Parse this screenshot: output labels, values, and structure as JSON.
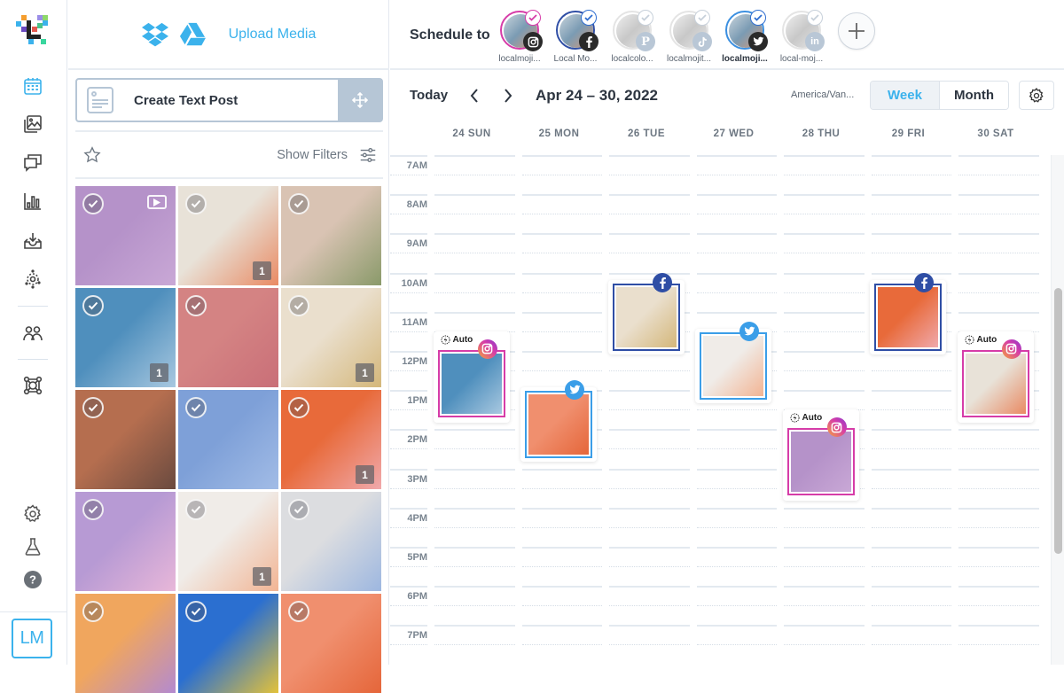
{
  "nav": {
    "items": [
      {
        "name": "calendar",
        "active": true
      },
      {
        "name": "media-library",
        "active": false
      },
      {
        "name": "conversations",
        "active": false
      },
      {
        "name": "analytics",
        "active": false
      },
      {
        "name": "inbox",
        "active": false
      },
      {
        "name": "discover",
        "active": false
      },
      {
        "name": "team",
        "active": false
      },
      {
        "name": "integrations",
        "active": false
      },
      {
        "name": "settings",
        "active": false
      },
      {
        "name": "labs",
        "active": false
      },
      {
        "name": "help",
        "active": false
      }
    ],
    "user_initials": "LM"
  },
  "media_panel": {
    "upload_label": "Upload Media",
    "sources": [
      "dropbox",
      "google-drive"
    ],
    "create_text_post_label": "Create Text Post",
    "show_filters_label": "Show Filters",
    "tiles": [
      {
        "desc": "yellow flowers on purple",
        "colors": [
          "#b592c9",
          "#c9a8d6"
        ],
        "count": null,
        "video": true
      },
      {
        "desc": "cocktails with limes",
        "colors": [
          "#e8e2d8",
          "#e98a63"
        ],
        "count": "1",
        "video": false
      },
      {
        "desc": "dining room with plants",
        "colors": [
          "#d9c3b3",
          "#8a9a6a"
        ],
        "count": null,
        "video": false
      },
      {
        "desc": "ice cubes with flowers",
        "colors": [
          "#4f8fbd",
          "#a8c8e0"
        ],
        "count": "1",
        "video": false
      },
      {
        "desc": "pink room with purple tree",
        "colors": [
          "#d48383",
          "#c96f78"
        ],
        "count": null,
        "video": false
      },
      {
        "desc": "orange on plates",
        "colors": [
          "#eadfcd",
          "#d4b77a"
        ],
        "count": "1",
        "video": false
      },
      {
        "desc": "woman on stairs",
        "colors": [
          "#b56e4f",
          "#6a4a3f"
        ],
        "count": null,
        "video": false
      },
      {
        "desc": "bouquet against blue sky",
        "colors": [
          "#7ea0d8",
          "#a2bce6"
        ],
        "count": null,
        "video": false
      },
      {
        "desc": "candle with orange backdrop",
        "colors": [
          "#e86a3a",
          "#f0a9ac"
        ],
        "count": "1",
        "video": false
      },
      {
        "desc": "lavender field with pink cloud",
        "colors": [
          "#b79ad4",
          "#e8b7d9"
        ],
        "count": null,
        "video": false
      },
      {
        "desc": "peach flowers and glasses",
        "colors": [
          "#f0ece8",
          "#f2b493"
        ],
        "count": "1",
        "video": false
      },
      {
        "desc": "woman with arm raised",
        "colors": [
          "#dcdde0",
          "#9db7e0"
        ],
        "count": null,
        "video": false
      },
      {
        "desc": "abstract yellow and purple flowers",
        "colors": [
          "#f0a65e",
          "#b38ad0"
        ],
        "count": null,
        "video": false
      },
      {
        "desc": "yellow window on blue wall",
        "colors": [
          "#2b6fd0",
          "#e3c23a"
        ],
        "count": null,
        "video": false
      },
      {
        "desc": "orange vase with flower",
        "colors": [
          "#f08f6e",
          "#e5663a"
        ],
        "count": null,
        "video": false
      }
    ]
  },
  "schedule": {
    "label": "Schedule to",
    "accounts": [
      {
        "name": "localmoji...",
        "network": "instagram",
        "selected": true,
        "ring": "#d63ca8",
        "bold": false
      },
      {
        "name": "Local Mo...",
        "network": "facebook",
        "selected": true,
        "ring": "#2f4ea5",
        "bold": false
      },
      {
        "name": "localcolo...",
        "network": "pinterest",
        "selected": false,
        "ring": "#dcdcdc",
        "bold": false
      },
      {
        "name": "localmojit...",
        "network": "tiktok",
        "selected": false,
        "ring": "#dcdcdc",
        "bold": false
      },
      {
        "name": "localmoji...",
        "network": "twitter",
        "selected": true,
        "ring": "#3b8fe0",
        "bold": true
      },
      {
        "name": "local-moj...",
        "network": "linkedin",
        "selected": false,
        "ring": "#dcdcdc",
        "bold": false
      }
    ],
    "add_account_label": "+"
  },
  "calendar": {
    "today_label": "Today",
    "range_label": "Apr 24 – 30, 2022",
    "timezone": "America/Van...",
    "views": {
      "week": "Week",
      "month": "Month",
      "active": "week"
    },
    "days": [
      "24 SUN",
      "25 MON",
      "26 TUE",
      "27 WED",
      "28 THU",
      "29 FRI",
      "30 SAT"
    ],
    "hours": [
      "7AM",
      "8AM",
      "9AM",
      "10AM",
      "11AM",
      "12PM",
      "1PM",
      "2PM",
      "3PM",
      "4PM",
      "5PM",
      "6PM",
      "7PM"
    ],
    "posts": [
      {
        "day": 0,
        "time": "11:45",
        "network": "instagram",
        "auto": true,
        "auto_label": "Auto",
        "desc": "ice cubes with flowers"
      },
      {
        "day": 1,
        "time": "12:45",
        "network": "twitter",
        "auto": false,
        "desc": "orange vase with flower"
      },
      {
        "day": 2,
        "time": "10:00",
        "network": "facebook",
        "auto": false,
        "desc": "orange on plates"
      },
      {
        "day": 3,
        "time": "11:15",
        "network": "twitter",
        "auto": false,
        "desc": "peach flowers and glasses"
      },
      {
        "day": 4,
        "time": "1:45",
        "network": "instagram",
        "auto": true,
        "auto_label": "Auto",
        "desc": "yellow flowers on purple"
      },
      {
        "day": 5,
        "time": "10:00",
        "network": "facebook",
        "auto": false,
        "desc": "candle with orange backdrop"
      },
      {
        "day": 6,
        "time": "11:45",
        "network": "instagram",
        "auto": true,
        "auto_label": "Auto",
        "desc": "cocktails with limes"
      }
    ]
  },
  "colors": {
    "accent": "#3bb2ec",
    "instagram": "#d63ca8",
    "facebook": "#2f4ea5",
    "twitter": "#3b9ee8",
    "text": "#2d3540",
    "muted": "#6d7782"
  }
}
